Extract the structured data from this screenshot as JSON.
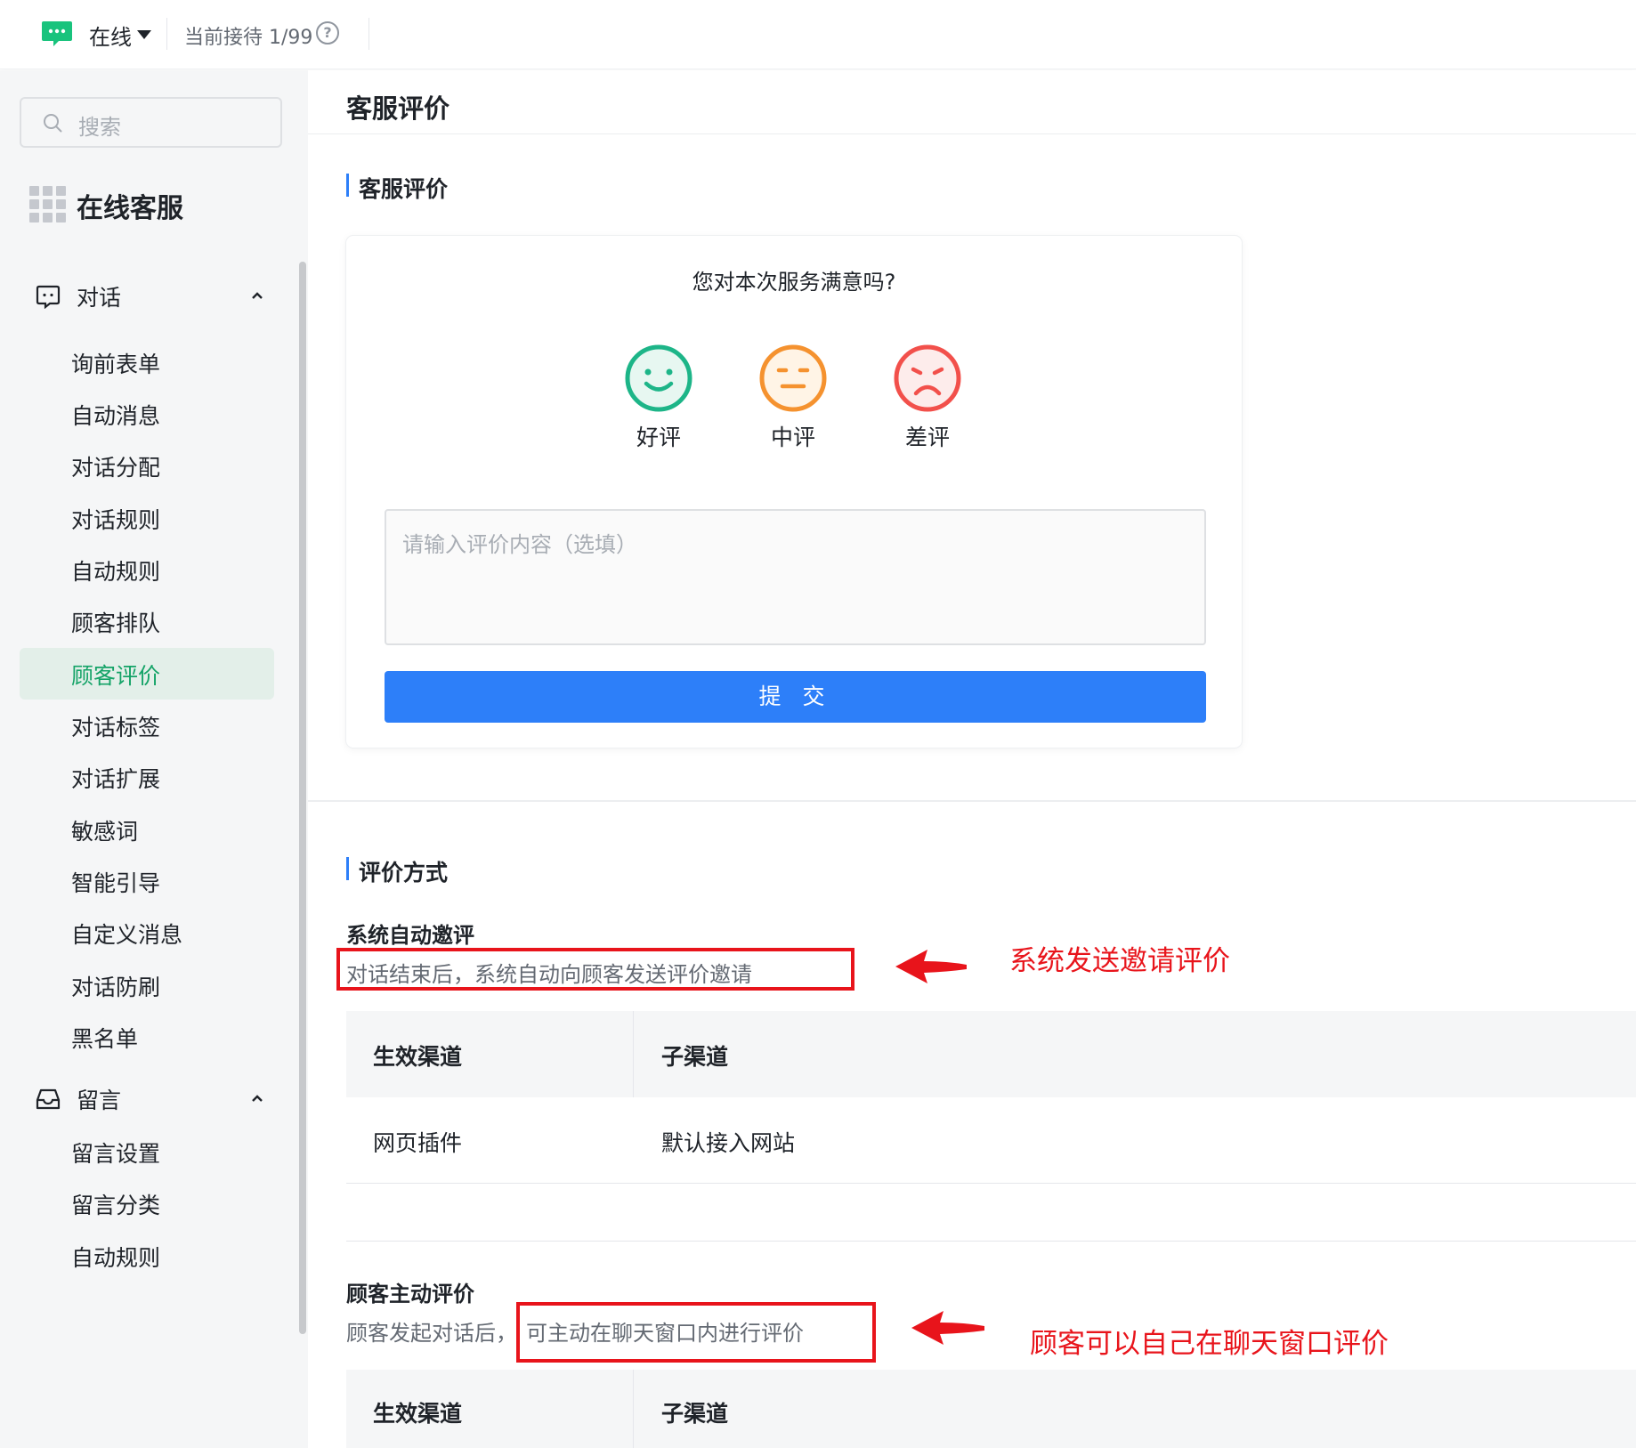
{
  "topbar": {
    "status": "在线",
    "reception": "当前接待 1/99",
    "help": "?"
  },
  "sidebar": {
    "search_placeholder": "搜索",
    "brand": "在线客服",
    "groups": [
      {
        "label": "对话",
        "icon": "chat-bubble-icon",
        "items": [
          "询前表单",
          "自动消息",
          "对话分配",
          "对话规则",
          "自动规则",
          "顾客排队",
          "顾客评价",
          "对话标签",
          "对话扩展",
          "敏感词",
          "智能引导",
          "自定义消息",
          "对话防刷",
          "黑名单"
        ]
      },
      {
        "label": "留言",
        "icon": "inbox-icon",
        "items": [
          "留言设置",
          "留言分类",
          "自动规则"
        ]
      }
    ],
    "active_item": "顾客评价"
  },
  "main": {
    "page_title": "客服评价",
    "section1_title": "客服评价",
    "card": {
      "question": "您对本次服务满意吗?",
      "ratings": [
        {
          "label": "好评",
          "icon": "smile-face-icon",
          "color": "#1db588"
        },
        {
          "label": "中评",
          "icon": "neutral-face-icon",
          "color": "#f5922f"
        },
        {
          "label": "差评",
          "icon": "sad-face-icon",
          "color": "#f2504b"
        }
      ],
      "comment_placeholder": "请输入评价内容（选填）",
      "submit": "提 交"
    },
    "section2_title": "评价方式",
    "auto_invite": {
      "title": "系统自动邀评",
      "desc": "对话结束后，系统自动向顾客发送评价邀请",
      "annotation": "系统发送邀请评价",
      "table": {
        "headers": [
          "生效渠道",
          "子渠道"
        ],
        "rows": [
          [
            "网页插件",
            "默认接入网站"
          ]
        ]
      }
    },
    "customer_initiated": {
      "title": "顾客主动评价",
      "desc_prefix": "顾客发起对话后，",
      "desc_highlight": "可主动在聊天窗口内进行评价",
      "annotation": "顾客可以自己在聊天窗口评价",
      "table": {
        "headers": [
          "生效渠道",
          "子渠道"
        ]
      }
    }
  },
  "colors": {
    "accent_green": "#14a367",
    "primary_blue": "#2d7ff9",
    "annotation_red": "#e8141b"
  }
}
